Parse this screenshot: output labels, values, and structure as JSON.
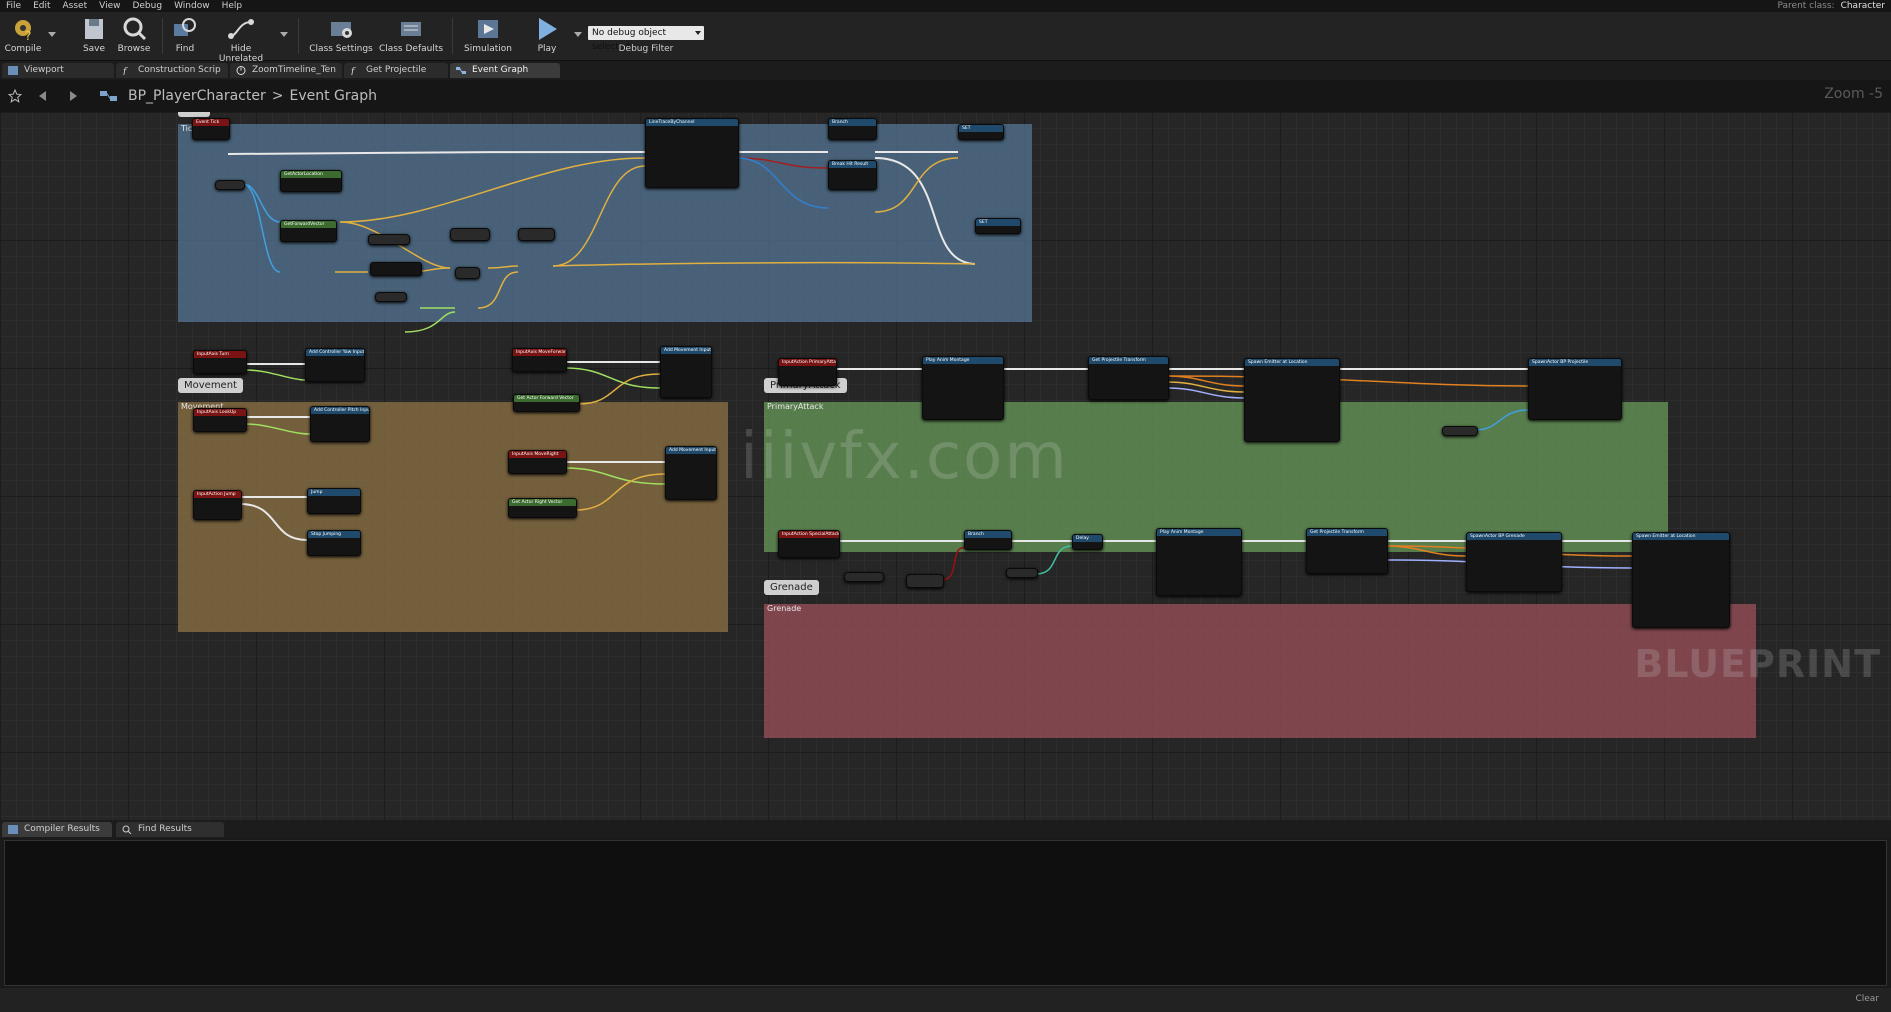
{
  "menu": [
    "File",
    "Edit",
    "Asset",
    "View",
    "Debug",
    "Window",
    "Help"
  ],
  "parent_class": {
    "label": "Parent class:",
    "value": "Character"
  },
  "toolbar": {
    "compile": "Compile",
    "save": "Save",
    "browse": "Browse",
    "find": "Find",
    "hide_unrelated": "Hide Unrelated",
    "class_settings": "Class Settings",
    "class_defaults": "Class Defaults",
    "simulation": "Simulation",
    "play": "Play",
    "debug_select": "No debug object selected",
    "debug_filter": "Debug Filter"
  },
  "tabs": [
    "Viewport",
    "Construction Scrip",
    "ZoomTimeline_Ten",
    "Get Projectile Tran",
    "Event Graph"
  ],
  "breadcrumb": {
    "blueprint": "BP_PlayerCharacter",
    "separator": ">",
    "graph": "Event Graph"
  },
  "zoom": "Zoom -5",
  "comments": {
    "tick": {
      "title": "Tick",
      "color": "#4e6a86"
    },
    "movement": {
      "title": "Movement",
      "color": "#7d6a44"
    },
    "primary": {
      "title": "PrimaryAttack",
      "color": "#5f7f4f"
    },
    "grenade": {
      "title": "Grenade",
      "color": "#8a5158"
    }
  },
  "nodes": {
    "event_tick": "Event Tick",
    "line_trace": "LineTraceByChannel",
    "branch_tick": "Branch",
    "set_target": "SET",
    "get_actor_location": "GetActorLocation",
    "get_forward_vector": "GetForwardVector",
    "break_hit": "Break Hit Result",
    "set_aim": "SET",
    "input_turn": "InputAxis Turn",
    "input_lookup": "InputAxis LookUp",
    "input_jump": "InputAction Jump",
    "input_forward": "InputAxis MoveForward",
    "input_right": "InputAxis MoveRight",
    "add_yaw": "Add Controller Yaw Input",
    "add_pitch": "Add Controller Pitch Input",
    "jump": "Jump",
    "stop_jumping": "Stop Jumping",
    "add_move_1": "Add Movement Input",
    "add_move_2": "Add Movement Input",
    "get_fwd_vec": "Get Actor Forward Vector",
    "get_right_vec": "Get Actor Right Vector",
    "input_primary": "InputAction PrimaryAttack",
    "play_montage_1": "Play Anim Montage",
    "get_proj_trans_1": "Get Projectile Transform",
    "spawn_emitter_1": "Spawn Emitter at Location",
    "spawn_actor_1": "SpawnActor BP Projectile",
    "input_grenade": "InputAction SpecialAttack",
    "branch_g": "Branch",
    "delay_g": "Delay",
    "play_montage_2": "Play Anim Montage",
    "get_proj_trans_2": "Get Projectile Transform",
    "spawn_actor_2": "SpawnActor BP Grenade",
    "spawn_emitter_2": "Spawn Emitter at Location"
  },
  "watermark": "iiivfx.com",
  "blueprint_watermark": "BLUEPRINT",
  "bottom_tabs": [
    "Compiler Results",
    "Find Results"
  ],
  "clear": "Clear"
}
